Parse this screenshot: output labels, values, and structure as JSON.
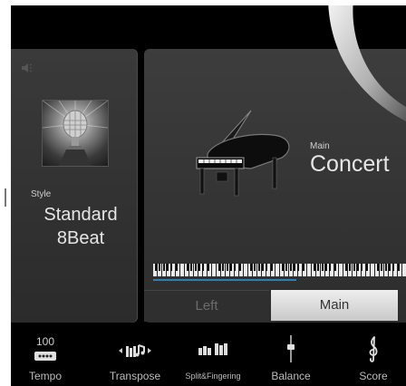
{
  "style": {
    "label": "Style",
    "name": "Standard\n8Beat",
    "name_line1": "Standard",
    "name_line2": "8Beat"
  },
  "voice": {
    "part_label": "Main",
    "name": "Concert"
  },
  "part_tabs": {
    "left": "Left",
    "main": "Main",
    "selected": "Main"
  },
  "bottom_bar": {
    "tempo": {
      "value": "100",
      "label": "Tempo"
    },
    "transpose": {
      "label": "Transpose"
    },
    "split_fingering": {
      "label": "Split&Fingering"
    },
    "balance": {
      "label": "Balance"
    },
    "score": {
      "label": "Score"
    }
  },
  "icons": {
    "speaker": "speaker-icon",
    "tempo": "tempo-icon",
    "transpose": "transpose-icon",
    "split": "split-fingering-icon",
    "balance": "balance-icon",
    "score": "treble-clef-icon"
  },
  "colors": {
    "accent_line": "#2c7fb0",
    "panel": "#343434",
    "selected_tab": "#dcdcdc"
  }
}
